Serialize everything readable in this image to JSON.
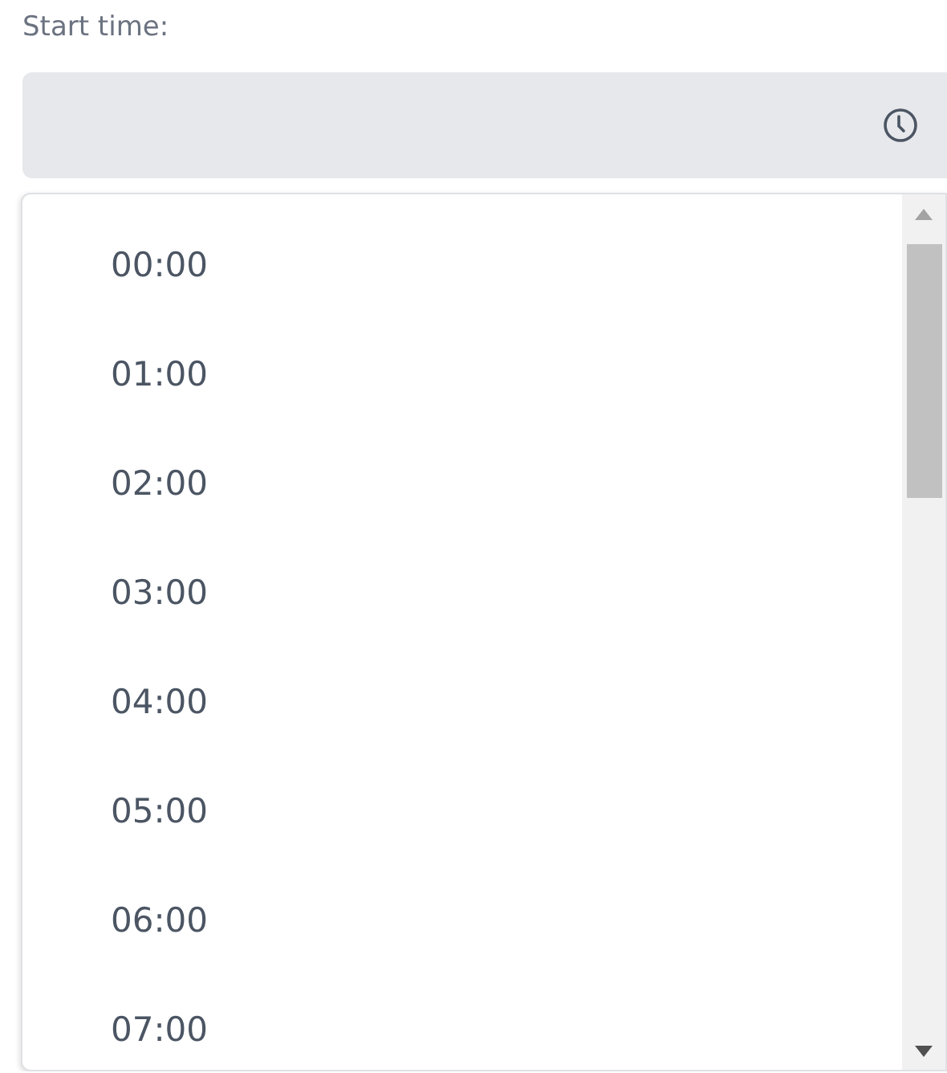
{
  "field": {
    "label": "Start time:"
  },
  "dropdown": {
    "options": [
      {
        "label": "00:00"
      },
      {
        "label": "01:00"
      },
      {
        "label": "02:00"
      },
      {
        "label": "03:00"
      },
      {
        "label": "04:00"
      },
      {
        "label": "05:00"
      },
      {
        "label": "06:00"
      },
      {
        "label": "07:00"
      }
    ]
  }
}
